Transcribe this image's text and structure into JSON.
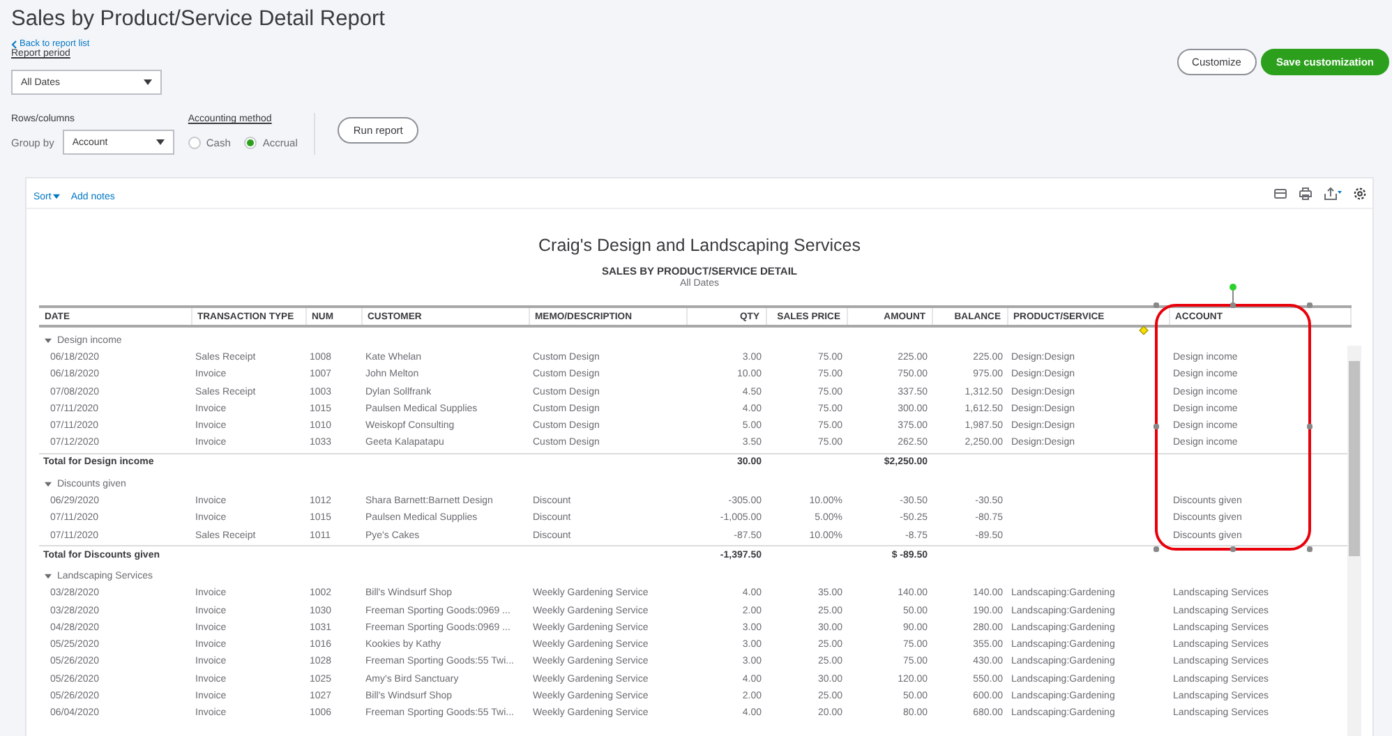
{
  "header": {
    "title": "Sales by Product/Service Detail Report",
    "back_link": "Back to report list",
    "report_period": {
      "label": "Report period",
      "value": "All Dates"
    },
    "rows_columns": {
      "label": "Rows/columns",
      "group_by_label": "Group by",
      "group_by_value": "Account"
    },
    "accounting_method": {
      "label": "Accounting method",
      "options": [
        {
          "label": "Cash",
          "selected": false
        },
        {
          "label": "Accrual",
          "selected": true
        }
      ]
    },
    "run_button": "Run report",
    "customize_button": "Customize",
    "save_button": "Save customization"
  },
  "report": {
    "toolbar": {
      "sort": "Sort",
      "add_notes": "Add notes"
    },
    "company": "Craig's Design and Landscaping Services",
    "title": "SALES BY PRODUCT/SERVICE DETAIL",
    "period": "All Dates",
    "columns": [
      "DATE",
      "TRANSACTION TYPE",
      "NUM",
      "CUSTOMER",
      "MEMO/DESCRIPTION",
      "QTY",
      "SALES PRICE",
      "AMOUNT",
      "BALANCE",
      "PRODUCT/SERVICE",
      "ACCOUNT"
    ],
    "groups": [
      {
        "name": "Design income",
        "expanded": true,
        "rows": [
          [
            "06/18/2020",
            "Sales Receipt",
            "1008",
            "Kate Whelan",
            "Custom Design",
            "3.00",
            "75.00",
            "225.00",
            "225.00",
            "Design:Design",
            "Design income"
          ],
          [
            "06/18/2020",
            "Invoice",
            "1007",
            "John Melton",
            "Custom Design",
            "10.00",
            "75.00",
            "750.00",
            "975.00",
            "Design:Design",
            "Design income"
          ],
          [
            "07/08/2020",
            "Sales Receipt",
            "1003",
            "Dylan Sollfrank",
            "Custom Design",
            "4.50",
            "75.00",
            "337.50",
            "1,312.50",
            "Design:Design",
            "Design income"
          ],
          [
            "07/11/2020",
            "Invoice",
            "1015",
            "Paulsen Medical Supplies",
            "Custom Design",
            "4.00",
            "75.00",
            "300.00",
            "1,612.50",
            "Design:Design",
            "Design income"
          ],
          [
            "07/11/2020",
            "Invoice",
            "1010",
            "Weiskopf Consulting",
            "Custom Design",
            "5.00",
            "75.00",
            "375.00",
            "1,987.50",
            "Design:Design",
            "Design income"
          ],
          [
            "07/12/2020",
            "Invoice",
            "1033",
            "Geeta Kalapatapu",
            "Custom Design",
            "3.50",
            "75.00",
            "262.50",
            "2,250.00",
            "Design:Design",
            "Design income"
          ]
        ],
        "total": {
          "label": "Total for Design income",
          "qty": "30.00",
          "amount": "$2,250.00"
        }
      },
      {
        "name": "Discounts given",
        "expanded": true,
        "rows": [
          [
            "06/29/2020",
            "Invoice",
            "1012",
            "Shara Barnett:Barnett Design",
            "Discount",
            "-305.00",
            "10.00%",
            "-30.50",
            "-30.50",
            "",
            "Discounts given"
          ],
          [
            "07/11/2020",
            "Invoice",
            "1015",
            "Paulsen Medical Supplies",
            "Discount",
            "-1,005.00",
            "5.00%",
            "-50.25",
            "-80.75",
            "",
            "Discounts given"
          ],
          [
            "07/11/2020",
            "Sales Receipt",
            "1011",
            "Pye's Cakes",
            "Discount",
            "-87.50",
            "10.00%",
            "-8.75",
            "-89.50",
            "",
            "Discounts given"
          ]
        ],
        "total": {
          "label": "Total for Discounts given",
          "qty": "-1,397.50",
          "amount": "$ -89.50"
        }
      },
      {
        "name": "Landscaping Services",
        "expanded": true,
        "rows": [
          [
            "03/28/2020",
            "Invoice",
            "1002",
            "Bill's Windsurf Shop",
            "Weekly Gardening Service",
            "4.00",
            "35.00",
            "140.00",
            "140.00",
            "Landscaping:Gardening",
            "Landscaping Services"
          ],
          [
            "03/28/2020",
            "Invoice",
            "1030",
            "Freeman Sporting Goods:0969 ...",
            "Weekly Gardening Service",
            "2.00",
            "25.00",
            "50.00",
            "190.00",
            "Landscaping:Gardening",
            "Landscaping Services"
          ],
          [
            "04/28/2020",
            "Invoice",
            "1031",
            "Freeman Sporting Goods:0969 ...",
            "Weekly Gardening Service",
            "3.00",
            "30.00",
            "90.00",
            "280.00",
            "Landscaping:Gardening",
            "Landscaping Services"
          ],
          [
            "05/25/2020",
            "Invoice",
            "1016",
            "Kookies by Kathy",
            "Weekly Gardening Service",
            "3.00",
            "25.00",
            "75.00",
            "355.00",
            "Landscaping:Gardening",
            "Landscaping Services"
          ],
          [
            "05/26/2020",
            "Invoice",
            "1028",
            "Freeman Sporting Goods:55 Twi...",
            "Weekly Gardening Service",
            "3.00",
            "25.00",
            "75.00",
            "430.00",
            "Landscaping:Gardening",
            "Landscaping Services"
          ],
          [
            "05/26/2020",
            "Invoice",
            "1025",
            "Amy's Bird Sanctuary",
            "Weekly Gardening Service",
            "4.00",
            "30.00",
            "120.00",
            "550.00",
            "Landscaping:Gardening",
            "Landscaping Services"
          ],
          [
            "05/26/2020",
            "Invoice",
            "1027",
            "Bill's Windsurf Shop",
            "Weekly Gardening Service",
            "2.00",
            "25.00",
            "50.00",
            "600.00",
            "Landscaping:Gardening",
            "Landscaping Services"
          ],
          [
            "06/04/2020",
            "Invoice",
            "1006",
            "Freeman Sporting Goods:55 Twi...",
            "Weekly Gardening Service",
            "4.00",
            "20.00",
            "80.00",
            "680.00",
            "Landscaping:Gardening",
            "Landscaping Services"
          ]
        ]
      }
    ]
  }
}
